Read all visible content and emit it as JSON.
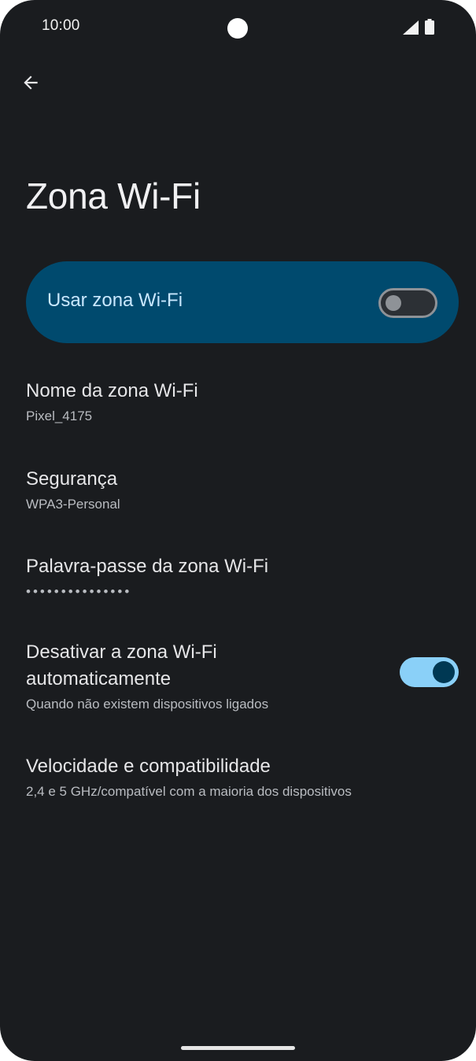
{
  "status_bar": {
    "time": "10:00",
    "icons": [
      "camera-cutout",
      "signal-icon",
      "battery-icon"
    ]
  },
  "nav": {
    "back_icon": "arrow-left-icon"
  },
  "page": {
    "title": "Zona Wi-Fi"
  },
  "main_switch": {
    "label": "Usar zona Wi-Fi",
    "state": "off",
    "card_color": "#004a6e"
  },
  "settings": [
    {
      "title": "Nome da zona Wi-Fi",
      "subtitle": "Pixel_4175"
    },
    {
      "title": "Segurança",
      "subtitle": "WPA3-Personal"
    },
    {
      "title": "Palavra-passe da zona Wi-Fi",
      "subtitle": "•••••••••••••••"
    },
    {
      "title_line1": "Desativar a zona Wi-Fi",
      "title_line2": "automaticamente",
      "subtitle": "Quando não existem dispositivos ligados",
      "switch_state": "on"
    },
    {
      "title": "Velocidade e compatibilidade",
      "subtitle": "2,4 e 5 GHz/compatível com a maioria dos dispositivos"
    }
  ],
  "colors": {
    "background": "#1a1c1f",
    "switch_on_track": "#8ad0f8",
    "switch_on_thumb": "#003853"
  }
}
